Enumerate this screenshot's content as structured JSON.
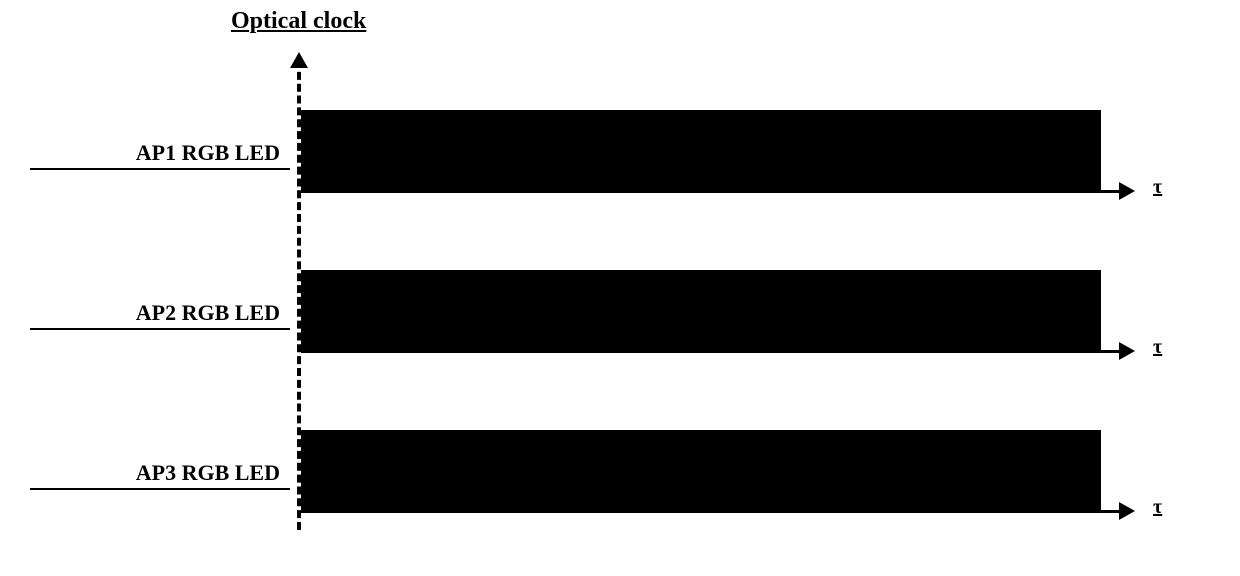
{
  "title": "Optical clock",
  "rows": [
    {
      "label": "AP1  RGB LED",
      "axis_symbol": "τ"
    },
    {
      "label": "AP2  RGB LED",
      "axis_symbol": "τ"
    },
    {
      "label": "AP3  RGB LED",
      "axis_symbol": "τ"
    }
  ],
  "chart_data": {
    "type": "bar",
    "title": "Optical clock",
    "xlabel": "τ",
    "series": [
      {
        "name": "AP1 RGB LED",
        "values": [
          1
        ]
      },
      {
        "name": "AP2 RGB LED",
        "values": [
          1
        ]
      },
      {
        "name": "AP3 RGB LED",
        "values": [
          1
        ]
      }
    ],
    "note": "Three RGB-LED access points emitting identical-duration pulses (filled bars) along a shared optical-clock time axis τ starting at a dashed vertical reference."
  }
}
